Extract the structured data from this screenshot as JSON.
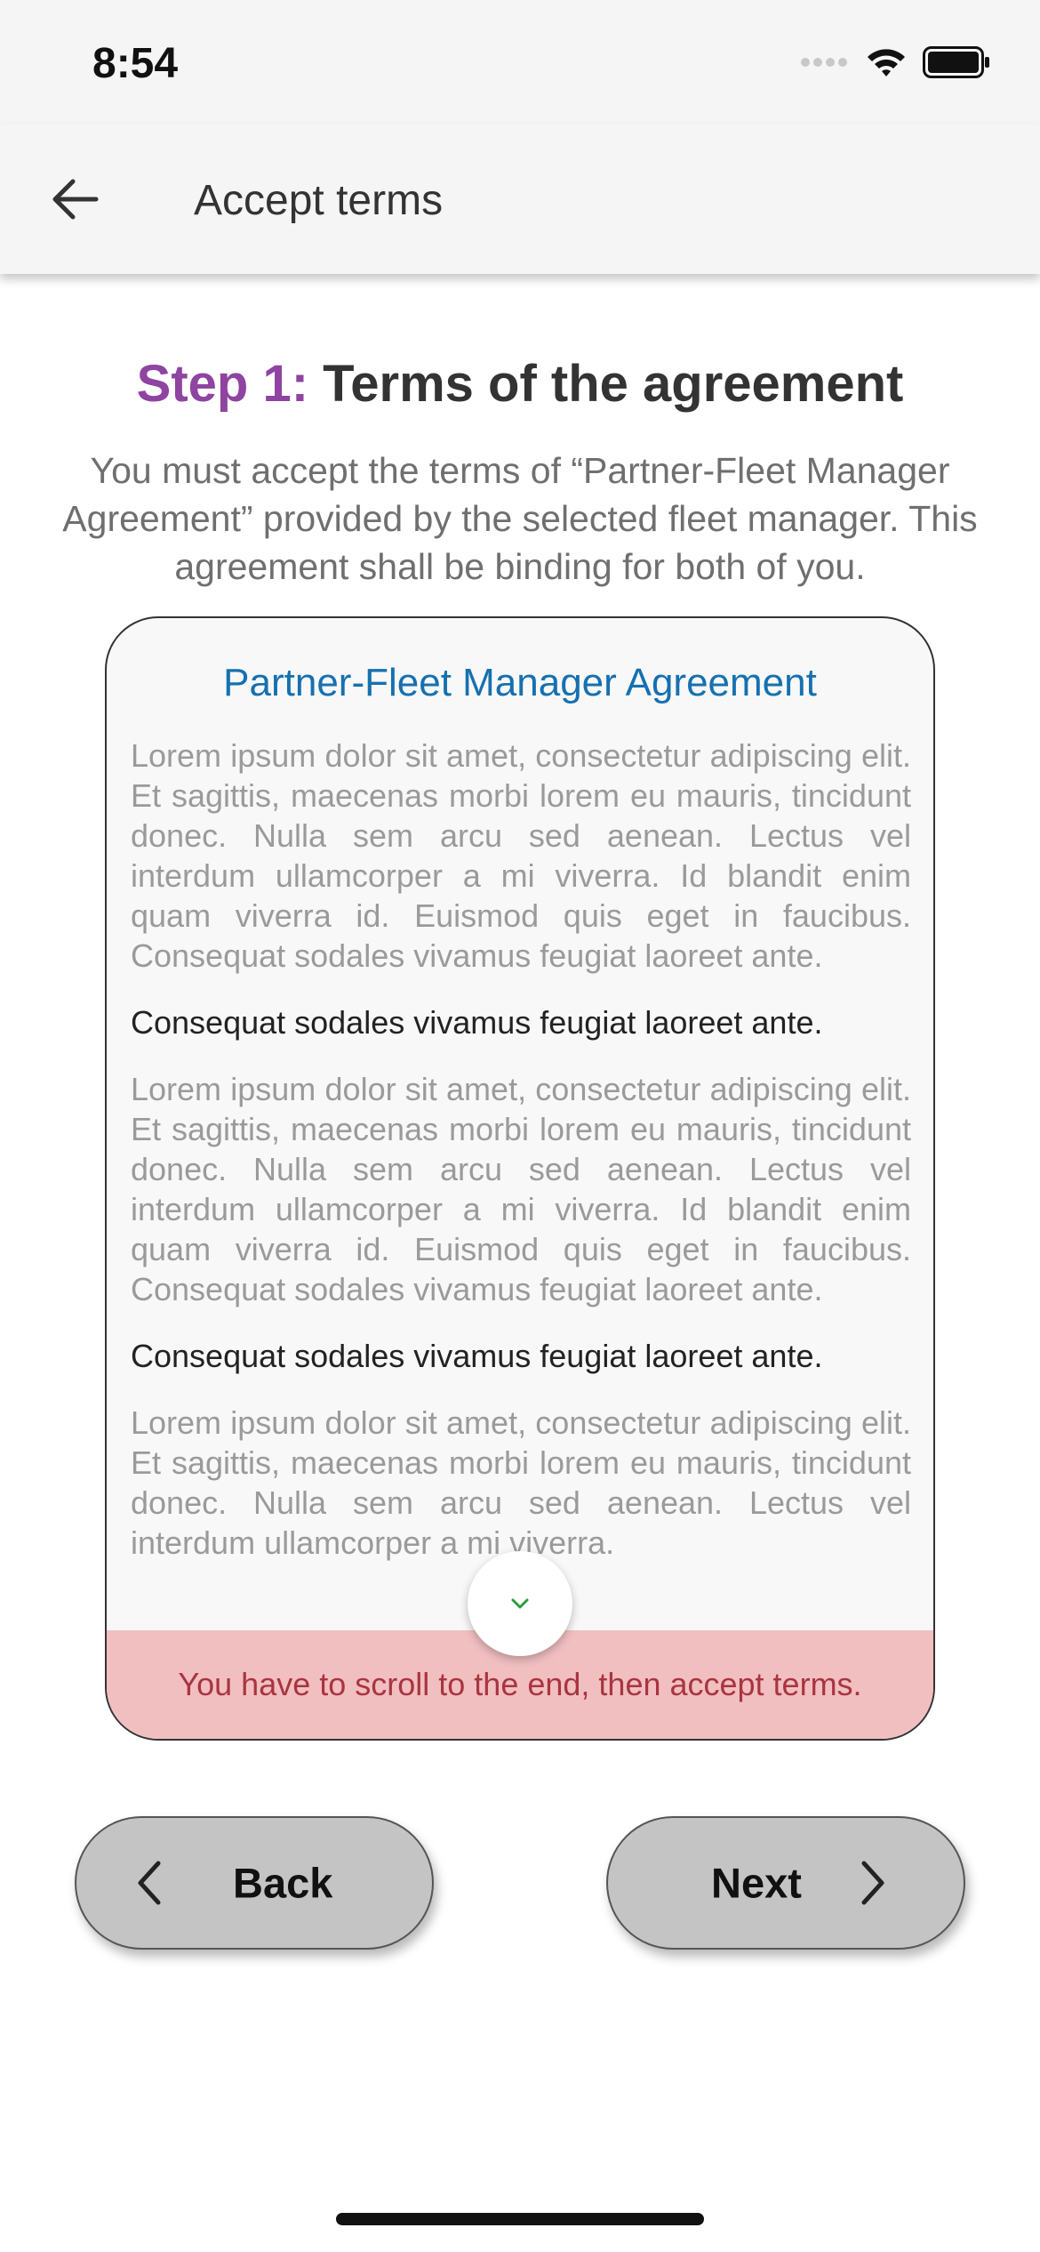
{
  "status_bar": {
    "time": "8:54",
    "icons": [
      "signal-icon",
      "wifi-icon",
      "battery-icon"
    ]
  },
  "app_bar": {
    "title": "Accept terms",
    "back_icon": "arrow-left-icon"
  },
  "step": {
    "label": "Step 1:",
    "title": "Terms of the agreement"
  },
  "description": "You must accept the terms of “Partner-Fleet Manager Agreement” provided by the selected fleet manager. This agreement shall be binding for both of you.",
  "agreement": {
    "title": "Partner-Fleet Manager Agreement",
    "paragraph_1": "Lorem ipsum dolor sit amet, consectetur adipiscing elit. Et sagittis, maecenas morbi lorem eu mauris, tincidunt donec. Nulla sem arcu sed aenean. Lectus vel interdum ullamcorper a mi viverra. Id blandit enim quam viverra id. Euismod quis eget in faucibus. Consequat sodales vivamus feugiat laoreet ante.",
    "heading_1": "Consequat sodales vivamus feugiat laoreet ante.",
    "paragraph_2": "Lorem ipsum dolor sit amet, consectetur adipiscing elit. Et sagittis, maecenas morbi lorem eu mauris, tincidunt donec. Nulla sem arcu sed aenean. Lectus vel interdum ullamcorper a mi viverra. Id blandit enim quam viverra id. Euismod quis eget in faucibus. Consequat sodales vivamus feugiat laoreet ante.",
    "heading_2": "Consequat sodales vivamus feugiat laoreet ante.",
    "paragraph_3": "Lorem ipsum dolor sit amet, consectetur adipiscing elit. Et sagittis, maecenas morbi lorem eu mauris, tincidunt donec. Nulla sem arcu sed aenean. Lectus vel interdum ullamcorper a mi viverra.",
    "scroll_warning": "You have to scroll to the end, then accept terms.",
    "scroll_icon": "chevron-down-icon"
  },
  "buttons": {
    "back_label": "Back",
    "next_label": "Next"
  },
  "colors": {
    "step_label": "#8e44a0",
    "agreement_title": "#1670b0",
    "warning_background": "#f2bfc1",
    "warning_text": "#a8353f",
    "scroll_chevron": "#2e9b3e",
    "button_background": "#c4c4c4"
  }
}
